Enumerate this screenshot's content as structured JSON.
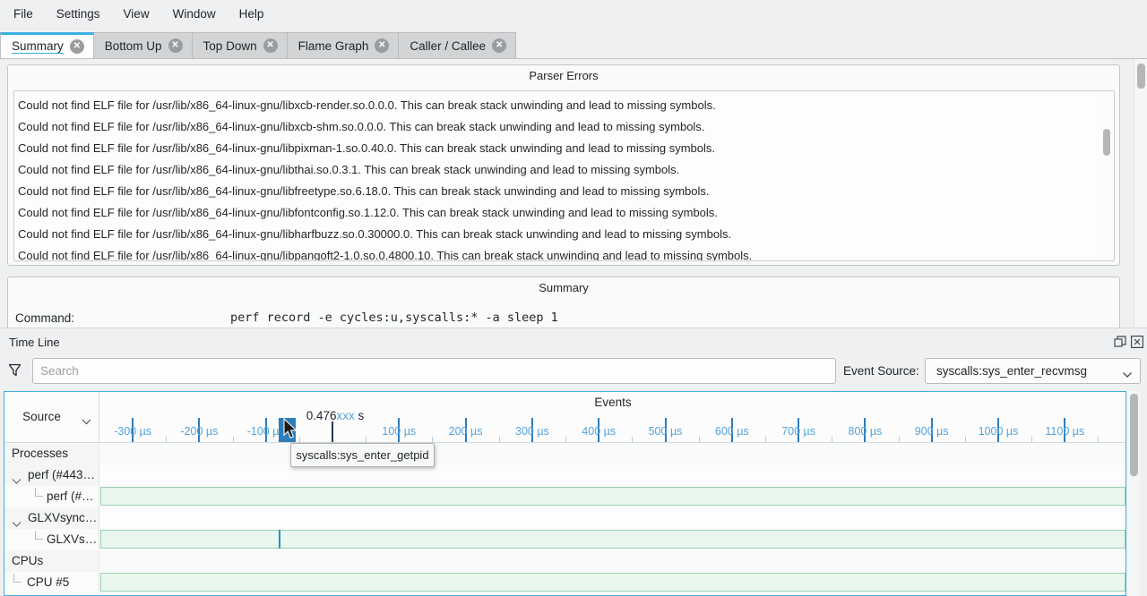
{
  "menu": {
    "items": [
      "File",
      "Settings",
      "View",
      "Window",
      "Help"
    ]
  },
  "tabs": [
    {
      "label": "Summary",
      "active": true
    },
    {
      "label": "Bottom Up",
      "active": false
    },
    {
      "label": "Top Down",
      "active": false
    },
    {
      "label": "Flame Graph",
      "active": false
    },
    {
      "label": "Caller / Callee",
      "active": false
    }
  ],
  "parser_errors": {
    "title": "Parser Errors",
    "items": [
      "Could not find ELF file for /usr/lib/x86_64-linux-gnu/libxcb-render.so.0.0.0. This can break stack unwinding and lead to missing symbols.",
      "Could not find ELF file for /usr/lib/x86_64-linux-gnu/libxcb-shm.so.0.0.0. This can break stack unwinding and lead to missing symbols.",
      "Could not find ELF file for /usr/lib/x86_64-linux-gnu/libpixman-1.so.0.40.0. This can break stack unwinding and lead to missing symbols.",
      "Could not find ELF file for /usr/lib/x86_64-linux-gnu/libthai.so.0.3.1. This can break stack unwinding and lead to missing symbols.",
      "Could not find ELF file for /usr/lib/x86_64-linux-gnu/libfreetype.so.6.18.0. This can break stack unwinding and lead to missing symbols.",
      "Could not find ELF file for /usr/lib/x86_64-linux-gnu/libfontconfig.so.1.12.0. This can break stack unwinding and lead to missing symbols.",
      "Could not find ELF file for /usr/lib/x86_64-linux-gnu/libharfbuzz.so.0.30000.0. This can break stack unwinding and lead to missing symbols.",
      "Could not find ELF file for /usr/lib/x86_64-linux-gnu/libpangoft2-1.0.so.0.4800.10. This can break stack unwinding and lead to missing symbols."
    ]
  },
  "summary": {
    "title": "Summary",
    "command_label": "Command:",
    "command": "perf record -e cycles:u,syscalls:* -a sleep 1"
  },
  "timeline": {
    "title": "Time Line",
    "search": {
      "placeholder": "Search"
    },
    "event_source": {
      "label": "Event Source:",
      "value": "syscalls:sys_enter_recvmsg"
    },
    "columns": {
      "source": "Source",
      "events": "Events"
    },
    "tooltip": "syscalls:sys_enter_getpid",
    "chart_data": {
      "type": "timeline",
      "x_axis": {
        "unit": "µs",
        "min_us": -350,
        "max_us": 1190,
        "minor_tick_step_us": 50,
        "major_ticks": [
          {
            "us": -300,
            "label": "-300 µs"
          },
          {
            "us": -200,
            "label": "-200 µs"
          },
          {
            "us": -100,
            "label": "-100 µs"
          },
          {
            "us": 100,
            "label": "100 µs"
          },
          {
            "us": 200,
            "label": "200 µs"
          },
          {
            "us": 300,
            "label": "300 µs"
          },
          {
            "us": 400,
            "label": "400 µs"
          },
          {
            "us": 500,
            "label": "500 µs"
          },
          {
            "us": 600,
            "label": "600 µs"
          },
          {
            "us": 700,
            "label": "700 µs"
          },
          {
            "us": 800,
            "label": "800 µs"
          },
          {
            "us": 900,
            "label": "900 µs"
          },
          {
            "us": 1000,
            "label": "1000 µs"
          },
          {
            "us": 1100,
            "label": "1100 µs"
          }
        ],
        "zero_label": {
          "time": "0.476",
          "fraction": "xxx",
          "unit": " s"
        }
      },
      "event_cluster_us": [
        -79,
        -76.5,
        -74,
        -71.5,
        -69,
        -66.5,
        -64,
        -61.5,
        -59,
        -56.5
      ],
      "rows": [
        {
          "type": "category",
          "label": "Processes",
          "depth": 0,
          "bar": false,
          "events_us": []
        },
        {
          "type": "parent",
          "label": "perf (#443…",
          "depth": 1,
          "expanded": true,
          "bar": false,
          "events_us": []
        },
        {
          "type": "child",
          "label": "perf (#…",
          "depth": 2,
          "bar": true,
          "events_us": []
        },
        {
          "type": "parent",
          "label": "GLXVsync…",
          "depth": 1,
          "expanded": true,
          "bar": false,
          "events_us": []
        },
        {
          "type": "child",
          "label": "GLXVs…",
          "depth": 2,
          "bar": true,
          "events_us": [
            -79
          ]
        },
        {
          "type": "category",
          "label": "CPUs",
          "depth": 0,
          "bar": false,
          "events_us": []
        },
        {
          "type": "child",
          "label": "CPU #5",
          "depth": 1,
          "bar": true,
          "events_us": []
        }
      ]
    },
    "colors": {
      "accent": "#3daee2",
      "major_tick": "#2d7dbb",
      "axis_label": "#56a3d9",
      "zero_tick": "#1d3d5c",
      "bar_fill": "#e9f7ee",
      "bar_border": "#98d0ae",
      "row_event": "#2d8fc9"
    }
  }
}
